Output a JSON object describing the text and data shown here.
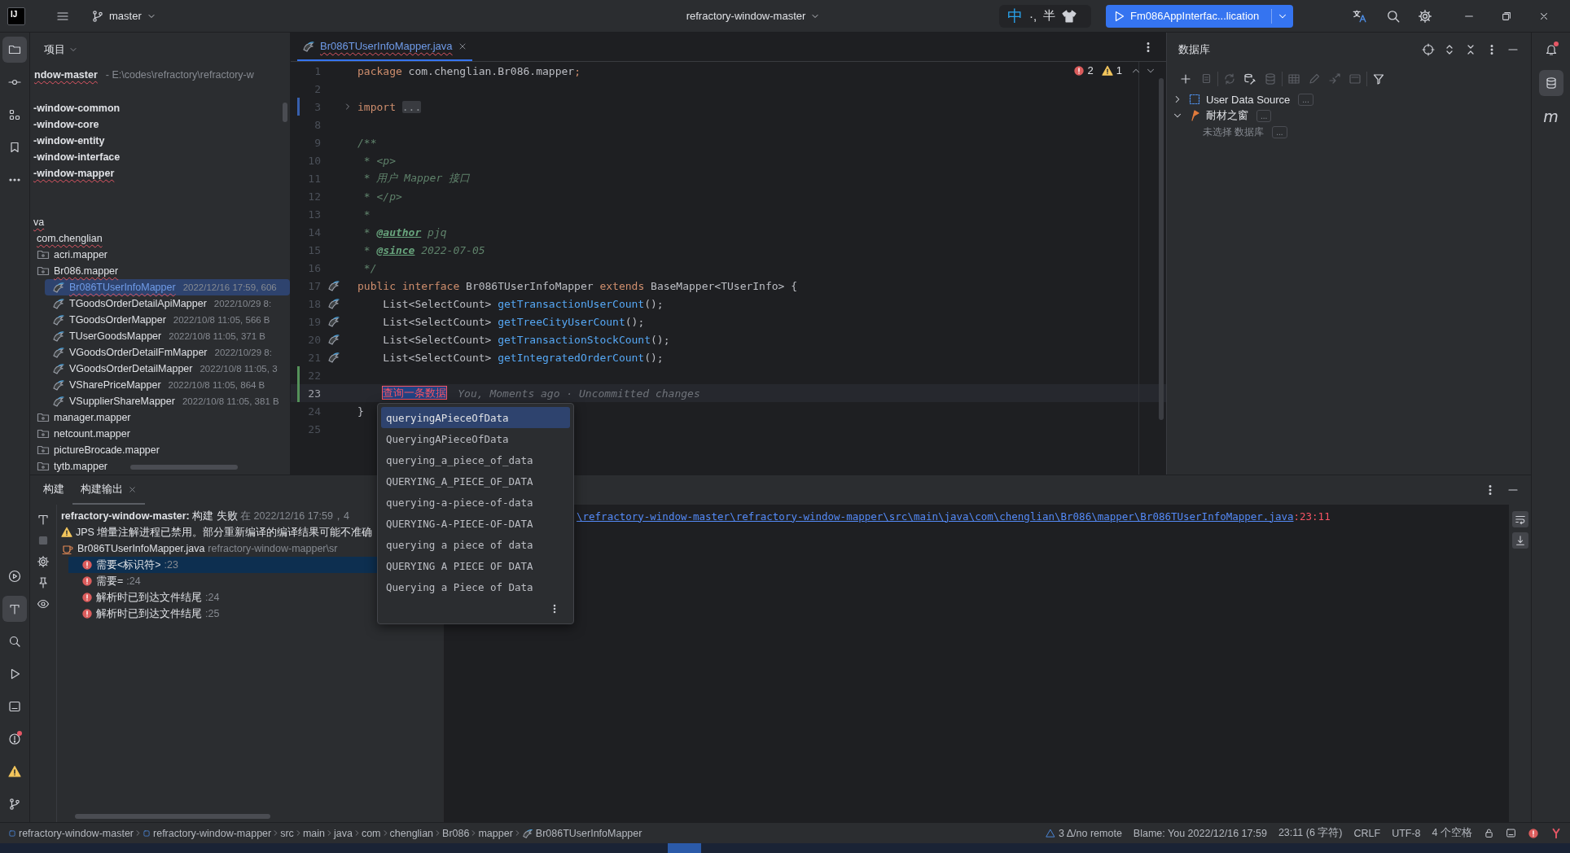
{
  "title_bar": {
    "logo": "IJ",
    "branch": "master",
    "project": "refractory-window-master",
    "ime": {
      "mode": "中",
      "punctuation": "·,",
      "width": "半"
    },
    "run_config": "Fm086AppInterfac...lication"
  },
  "left_toolbar": {
    "top": [
      {
        "kind": "folder",
        "selected": true,
        "alert": false
      },
      {
        "kind": "commit",
        "selected": false,
        "alert": false
      },
      {
        "kind": "structure",
        "selected": false,
        "alert": false
      },
      {
        "kind": "bookmark",
        "selected": false,
        "alert": false
      },
      {
        "kind": "more",
        "selected": false,
        "alert": false
      }
    ],
    "bottom": [
      {
        "kind": "services",
        "selected": false,
        "alert": false
      },
      {
        "kind": "build",
        "selected": true,
        "alert": false
      },
      {
        "kind": "search",
        "selected": false,
        "alert": false
      },
      {
        "kind": "run",
        "selected": false,
        "alert": false
      },
      {
        "kind": "terminal",
        "selected": false,
        "alert": false
      },
      {
        "kind": "problems",
        "selected": false,
        "alert": true
      },
      {
        "kind": "warning",
        "selected": false,
        "alert": false
      },
      {
        "kind": "git",
        "selected": false,
        "alert": false
      }
    ]
  },
  "project_panel": {
    "title": "项目",
    "root": {
      "name": "ndow-master",
      "path": "- E:\\codes\\refractory\\refractory-w",
      "error": true
    },
    "modules": [
      {
        "name": "-window-common",
        "error": false
      },
      {
        "name": "-window-core",
        "error": false
      },
      {
        "name": "-window-entity",
        "error": false
      },
      {
        "name": "-window-interface",
        "error": false
      },
      {
        "name": "-window-mapper",
        "error": true
      }
    ],
    "tree": [
      {
        "name": "va",
        "selected": false,
        "error": true,
        "children": [
          {
            "name": "com.chenglian",
            "selected": false,
            "error": true,
            "children": [
              {
                "name": "acri.mapper",
                "kind": "package",
                "selected": false,
                "error": false
              },
              {
                "name": "Br086.mapper",
                "kind": "package",
                "selected": false,
                "error": true,
                "children": [
                  {
                    "name": "Br086TUserInfoMapper",
                    "kind": "file",
                    "meta": "2022/12/16 17:59, 606",
                    "selected": true,
                    "modified": true,
                    "error": true
                  },
                  {
                    "name": "TGoodsOrderDetailApiMapper",
                    "kind": "file",
                    "meta": "2022/10/29 8:",
                    "selected": false,
                    "modified": false,
                    "error": false
                  },
                  {
                    "name": "TGoodsOrderMapper",
                    "kind": "file",
                    "meta": "2022/10/8 11:05, 566 B",
                    "selected": false,
                    "modified": false,
                    "error": false
                  },
                  {
                    "name": "TUserGoodsMapper",
                    "kind": "file",
                    "meta": "2022/10/8 11:05, 371 B",
                    "selected": false,
                    "modified": false,
                    "error": false
                  },
                  {
                    "name": "VGoodsOrderDetailFmMapper",
                    "kind": "file",
                    "meta": "2022/10/29 8:",
                    "selected": false,
                    "modified": false,
                    "error": false
                  },
                  {
                    "name": "VGoodsOrderDetailMapper",
                    "kind": "file",
                    "meta": "2022/10/8 11:05, 3",
                    "selected": false,
                    "modified": false,
                    "error": false
                  },
                  {
                    "name": "VSharePriceMapper",
                    "kind": "file",
                    "meta": "2022/10/8 11:05, 864 B",
                    "selected": false,
                    "modified": false,
                    "error": false
                  },
                  {
                    "name": "VSupplierShareMapper",
                    "kind": "file",
                    "meta": "2022/10/8 11:05, 381 B",
                    "selected": false,
                    "modified": false,
                    "error": false
                  }
                ]
              },
              {
                "name": "manager.mapper",
                "kind": "package",
                "selected": false,
                "error": false
              },
              {
                "name": "netcount.mapper",
                "kind": "package",
                "selected": false,
                "error": false
              },
              {
                "name": "pictureBrocade.mapper",
                "kind": "package",
                "selected": false,
                "error": false
              },
              {
                "name": "tytb.mapper",
                "kind": "package",
                "selected": false,
                "error": false
              }
            ]
          }
        ]
      }
    ]
  },
  "editor": {
    "tab": {
      "name": "Br086TUserInfoMapper.java",
      "selected": true,
      "modified": true,
      "error": true
    },
    "errors": "2",
    "warnings": "1",
    "lines": [
      {
        "n": "1",
        "kind": "unchanged",
        "marker": false,
        "fold": false,
        "current": false,
        "tokens": [
          {
            "kind": "keyword",
            "t": "package"
          },
          {
            "kind": "plain",
            "t": " com.chenglian.Br086.mapper"
          },
          {
            "kind": "keyword",
            "t": ";"
          }
        ]
      },
      {
        "n": "2",
        "kind": "unchanged",
        "marker": false,
        "fold": false,
        "current": false
      },
      {
        "n": "3",
        "kind": "modified",
        "marker": false,
        "fold": true,
        "current": false,
        "tokens": [
          {
            "kind": "keyword",
            "t": "import "
          },
          {
            "kind": "folded",
            "t": "..."
          }
        ]
      },
      {
        "n": "8",
        "kind": "unchanged",
        "marker": false,
        "fold": false,
        "current": false
      },
      {
        "n": "9",
        "kind": "unchanged",
        "marker": false,
        "fold": false,
        "current": false,
        "tokens": [
          {
            "kind": "doc",
            "t": "/**"
          }
        ]
      },
      {
        "n": "10",
        "kind": "unchanged",
        "marker": false,
        "fold": false,
        "current": false,
        "tokens": [
          {
            "kind": "doc",
            "t": " * <p>"
          }
        ]
      },
      {
        "n": "11",
        "kind": "unchanged",
        "marker": false,
        "fold": false,
        "current": false,
        "tokens": [
          {
            "kind": "doc",
            "t": " * 用户 Mapper 接口"
          }
        ]
      },
      {
        "n": "12",
        "kind": "unchanged",
        "marker": false,
        "fold": false,
        "current": false,
        "tokens": [
          {
            "kind": "doc",
            "t": " * </p>"
          }
        ]
      },
      {
        "n": "13",
        "kind": "unchanged",
        "marker": false,
        "fold": false,
        "current": false,
        "tokens": [
          {
            "kind": "doc",
            "t": " *"
          }
        ]
      },
      {
        "n": "14",
        "kind": "unchanged",
        "marker": false,
        "fold": false,
        "current": false,
        "tokens": [
          {
            "kind": "doc",
            "t": " * "
          },
          {
            "kind": "doctag",
            "t": "@author"
          },
          {
            "kind": "doc",
            "t": " pjq"
          }
        ]
      },
      {
        "n": "15",
        "kind": "unchanged",
        "marker": false,
        "fold": false,
        "current": false,
        "tokens": [
          {
            "kind": "doc",
            "t": " * "
          },
          {
            "kind": "doctag",
            "t": "@since"
          },
          {
            "kind": "doc",
            "t": " 2022-07-05"
          }
        ]
      },
      {
        "n": "16",
        "kind": "unchanged",
        "marker": false,
        "fold": false,
        "current": false,
        "tokens": [
          {
            "kind": "doc",
            "t": " */"
          }
        ]
      },
      {
        "n": "17",
        "kind": "unchanged",
        "marker": true,
        "fold": false,
        "current": false,
        "tokens": [
          {
            "kind": "keyword",
            "t": "public interface "
          },
          {
            "kind": "plain",
            "t": "Br086TUserInfoMapper "
          },
          {
            "kind": "keyword",
            "t": "extends "
          },
          {
            "kind": "plain",
            "t": "BaseMapper<TUserInfo> {"
          }
        ]
      },
      {
        "n": "18",
        "kind": "unchanged",
        "marker": true,
        "fold": false,
        "current": false,
        "tokens": [
          {
            "kind": "plain",
            "t": "    List<SelectCount> "
          },
          {
            "kind": "method",
            "t": "getTransactionUserCount"
          },
          {
            "kind": "plain",
            "t": "();"
          }
        ]
      },
      {
        "n": "19",
        "kind": "unchanged",
        "marker": true,
        "fold": false,
        "current": false,
        "tokens": [
          {
            "kind": "plain",
            "t": "    List<SelectCount> "
          },
          {
            "kind": "method",
            "t": "getTreeCityUserCount"
          },
          {
            "kind": "plain",
            "t": "();"
          }
        ]
      },
      {
        "n": "20",
        "kind": "unchanged",
        "marker": true,
        "fold": false,
        "current": false,
        "tokens": [
          {
            "kind": "plain",
            "t": "    List<SelectCount> "
          },
          {
            "kind": "method",
            "t": "getTransactionStockCount"
          },
          {
            "kind": "plain",
            "t": "();"
          }
        ]
      },
      {
        "n": "21",
        "kind": "unchanged",
        "marker": true,
        "fold": false,
        "current": false,
        "tokens": [
          {
            "kind": "plain",
            "t": "    List<SelectCount> "
          },
          {
            "kind": "method",
            "t": "getIntegratedOrderCount"
          },
          {
            "kind": "plain",
            "t": "();"
          }
        ]
      },
      {
        "n": "22",
        "kind": "added",
        "marker": false,
        "fold": false,
        "current": false
      },
      {
        "n": "23",
        "kind": "added",
        "marker": false,
        "fold": false,
        "current": true,
        "indented": true,
        "tokens": [
          {
            "kind": "error",
            "t": "查询一条数据"
          }
        ],
        "hint": "You, Moments ago · Uncommitted changes"
      },
      {
        "n": "24",
        "kind": "unchanged",
        "marker": false,
        "fold": false,
        "current": false,
        "tokens": [
          {
            "kind": "plain",
            "t": "}"
          }
        ]
      },
      {
        "n": "25",
        "kind": "unchanged",
        "marker": false,
        "fold": false,
        "current": false
      }
    ],
    "completion": {
      "items": [
        {
          "text": "queryingAPieceOfData",
          "selected": true
        },
        {
          "text": "QueryingAPieceOfData",
          "selected": false
        },
        {
          "text": "querying_a_piece_of_data",
          "selected": false
        },
        {
          "text": "QUERYING_A_PIECE_OF_DATA",
          "selected": false
        },
        {
          "text": "querying-a-piece-of-data",
          "selected": false
        },
        {
          "text": "QUERYING-A-PIECE-OF-DATA",
          "selected": false
        },
        {
          "text": "querying a piece of data",
          "selected": false
        },
        {
          "text": "QUERYING A PIECE OF DATA",
          "selected": false
        },
        {
          "text": "Querying a Piece of Data",
          "selected": false
        }
      ]
    }
  },
  "database_panel": {
    "title": "数据库",
    "toolbar": [
      [
        {
          "kind": "add",
          "disabled": false
        },
        {
          "kind": "copy",
          "disabled": true
        }
      ],
      [
        {
          "kind": "refresh",
          "disabled": true
        },
        {
          "kind": "tools",
          "disabled": false
        },
        {
          "kind": "database",
          "disabled": true
        }
      ],
      [
        {
          "kind": "table",
          "disabled": true
        },
        {
          "kind": "edit",
          "disabled": true
        },
        {
          "kind": "jump",
          "disabled": true
        },
        {
          "kind": "console",
          "disabled": true
        }
      ],
      [
        {
          "kind": "filter",
          "disabled": false
        }
      ]
    ],
    "tree": [
      {
        "name": "User Data Source",
        "kind": "datasource",
        "expanded": false,
        "more": "..."
      },
      {
        "name": "耐材之窗",
        "kind": "project",
        "expanded": true,
        "more": "...",
        "children": [
          {
            "name": "未选择 数据库",
            "more": "..."
          }
        ]
      }
    ]
  },
  "right_toolbar": [
    {
      "kind": "bell",
      "selected": false,
      "alert": true
    },
    {
      "kind": "database",
      "selected": true,
      "alert": false
    },
    {
      "kind": "maven",
      "selected": false,
      "alert": false,
      "label": "m"
    }
  ],
  "build_panel": {
    "tabs": [
      {
        "label": "构建",
        "selected": false,
        "closable": false
      },
      {
        "label": "构建输出",
        "selected": true,
        "closable": true
      }
    ],
    "toolbar": [
      {
        "kind": "hammer",
        "disabled": false
      },
      {
        "kind": "stop",
        "disabled": true
      },
      {
        "kind": "settings",
        "disabled": false
      },
      {
        "kind": "pin",
        "disabled": false
      },
      {
        "kind": "eye",
        "disabled": false
      }
    ],
    "summary": {
      "project": "refractory-window-master:",
      "status": "构建 失败",
      "time": "在 2022/12/16 17:59，4"
    },
    "warning": "JPS 增量注解进程已禁用。部分重新编译的编译结果可能不准确",
    "file": {
      "name": "Br086TUserInfoMapper.java",
      "path": "refractory-window-mapper\\sr",
      "errors": [
        {
          "message": "需要<标识符>",
          "location": ":23",
          "selected": true
        },
        {
          "message": "需要=",
          "location": ":24",
          "selected": false
        },
        {
          "message": "解析时已到达文件结尾",
          "location": ":24",
          "selected": false
        },
        {
          "message": "解析时已到达文件结尾",
          "location": ":25",
          "selected": false
        }
      ]
    },
    "console": {
      "path": "\\refractory-window-master\\refractory-window-mapper\\src\\main\\java\\com\\chenglian\\Br086\\mapper\\Br086TUserInfoMapper.java",
      "position": ":23:11"
    }
  },
  "status_bar": {
    "breadcrumbs": [
      {
        "text": "refractory-window-master",
        "kind": "module"
      },
      {
        "text": "refractory-window-mapper",
        "kind": "module"
      },
      {
        "text": "src",
        "kind": "dir"
      },
      {
        "text": "main",
        "kind": "dir"
      },
      {
        "text": "java",
        "kind": "dir"
      },
      {
        "text": "com",
        "kind": "dir"
      },
      {
        "text": "chenglian",
        "kind": "dir"
      },
      {
        "text": "Br086",
        "kind": "dir"
      },
      {
        "text": "mapper",
        "kind": "dir"
      },
      {
        "text": "Br086TUserInfoMapper",
        "kind": "file"
      }
    ],
    "vcs": "3 Δ/no remote",
    "blame": "Blame: You 2022/12/16 17:59",
    "position": "23:11 (6 字符)",
    "line_ending": "CRLF",
    "encoding": "UTF-8",
    "indent": "4 个空格"
  }
}
